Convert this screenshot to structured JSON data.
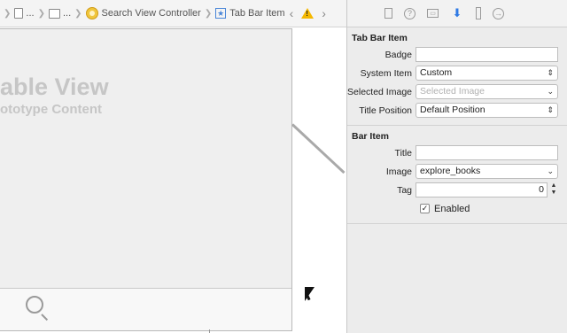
{
  "breadcrumbs": [
    {
      "label": "...",
      "icon": "file-icon"
    },
    {
      "label": "...",
      "icon": "view-icon"
    },
    {
      "label": "Search View Controller",
      "icon": "view-controller-icon"
    },
    {
      "label": "Tab Bar Item",
      "icon": "star-icon"
    }
  ],
  "canvas": {
    "table_view_title": "able View",
    "table_view_subtitle": "ototype Content"
  },
  "inspector": {
    "tabs": [
      "file-inspector-icon",
      "quick-help-icon",
      "identity-inspector-icon",
      "attributes-inspector-icon",
      "size-inspector-icon",
      "connections-inspector-icon"
    ],
    "tab_bar_item": {
      "title": "Tab Bar Item",
      "badge_label": "Badge",
      "badge_value": "",
      "system_item_label": "System Item",
      "system_item_value": "Custom",
      "selected_image_label": "Selected Image",
      "selected_image_placeholder": "Selected Image",
      "title_position_label": "Title Position",
      "title_position_value": "Default Position"
    },
    "bar_item": {
      "title": "Bar Item",
      "title_label": "Title",
      "title_value": "",
      "image_label": "Image",
      "image_value": "explore_books",
      "tag_label": "Tag",
      "tag_value": "0",
      "enabled_label": "Enabled",
      "enabled_checked": true
    }
  },
  "colors": {
    "accent": "#2f7ae5",
    "warning": "#f5b800"
  }
}
